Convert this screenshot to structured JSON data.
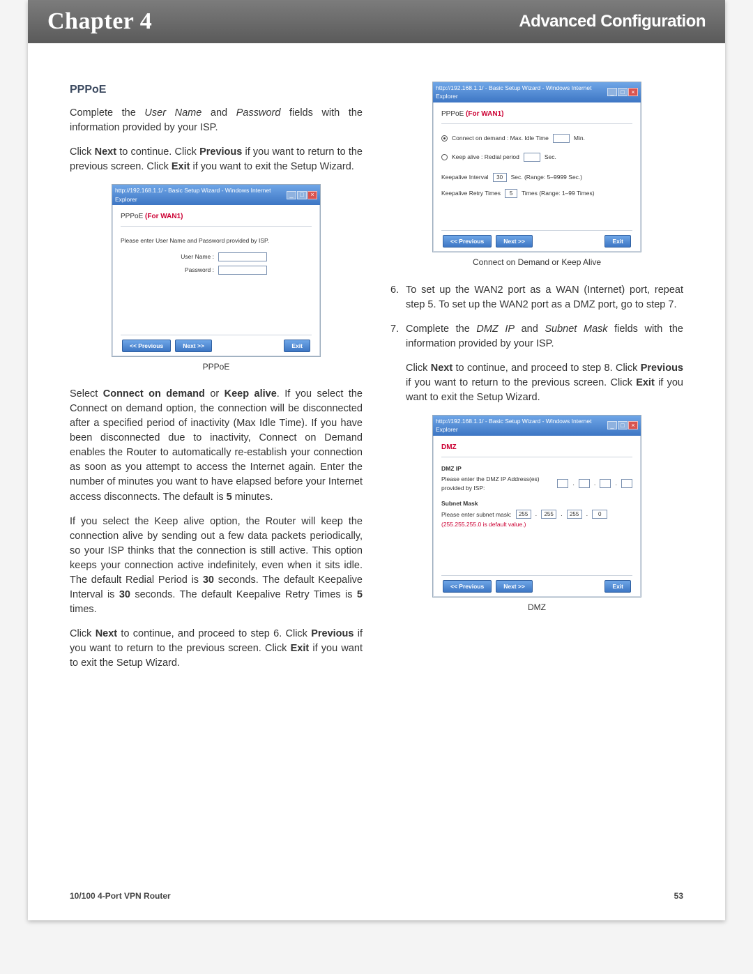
{
  "header": {
    "chapter": "Chapter 4",
    "section": "Advanced Configuration"
  },
  "left": {
    "heading": "PPPoE",
    "p1_a": "Complete the ",
    "p1_user_name": "User Name",
    "p1_b": " and ",
    "p1_password": "Password",
    "p1_c": " fields with the information provided by your ISP.",
    "p2_a": "Click ",
    "p2_next": "Next",
    "p2_b": " to continue. Click ",
    "p2_prev": "Previous",
    "p2_c": " if you want to return to the previous screen. Click ",
    "p2_exit": "Exit",
    "p2_d": " if you want to exit the Setup Wizard.",
    "fig1_caption": "PPPoE",
    "p3_a": "Select ",
    "p3_b1": "Connect on demand",
    "p3_b": " or ",
    "p3_b2": "Keep alive",
    "p3_c": ". If you select the Connect on demand option, the connection will be disconnected after a specified period of inactivity (Max Idle Time). If you have been disconnected due to inactivity, Connect on Demand enables the Router to automatically re-establish your connection as soon as you attempt to access the Internet again. Enter the number of minutes you want to have elapsed before your Internet access disconnects. The default is ",
    "p3_d": "5",
    "p3_e": " minutes.",
    "p4_a": "If you select the Keep alive option, the Router will keep the connection alive by sending out a few data packets periodically, so your ISP thinks that the connection is still active. This option keeps your connection active indefinitely, even when it sits idle. The default Redial Period is ",
    "p4_b1": "30",
    "p4_b": " seconds. The default Keepalive Interval is ",
    "p4_b2": "30",
    "p4_c": " seconds. The default Keepalive Retry Times is ",
    "p4_b3": "5",
    "p4_d": " times.",
    "p5_a": "Click ",
    "p5_next": "Next",
    "p5_b": " to continue, and proceed to step 6. Click ",
    "p5_prev": "Previous",
    "p5_c": " if you want to return to the previous screen. Click ",
    "p5_exit": "Exit",
    "p5_d": " if you want to exit the Setup Wizard."
  },
  "right": {
    "fig2_caption": "Connect on Demand or Keep Alive",
    "step6_num": "6.",
    "step6": "To set up the WAN2 port as a WAN (Internet) port, repeat step 5. To set up the WAN2 port as a DMZ port, go to step 7.",
    "step7_num": "7.",
    "step7_a": "Complete the ",
    "step7_dmz": "DMZ IP",
    "step7_b": " and ",
    "step7_sm": "Subnet Mask",
    "step7_c": " fields with the information provided by your ISP.",
    "p7b_a": "Click ",
    "p7b_next": "Next",
    "p7b_b": " to continue, and proceed to step 8. Click ",
    "p7b_prev": "Previous",
    "p7b_c": " if you want to return to the previous screen. Click ",
    "p7b_exit": "Exit",
    "p7b_d": " if you want to exit the Setup Wizard.",
    "fig3_caption": "DMZ"
  },
  "win": {
    "title": "http://192.168.1.1/ - Basic Setup Wizard - Windows Internet Explorer",
    "pppoe_header_a": "PPPoE ",
    "pppoe_header_b": "(For WAN1)",
    "pppoe_instruct": "Please enter User Name and Password provided by ISP.",
    "lbl_user": "User Name :",
    "lbl_pass": "Password :",
    "btn_prev": "<< Previous",
    "btn_next": "Next >>",
    "btn_exit": "Exit",
    "ka_connect_demand": "Connect on demand : Max. Idle Time",
    "ka_min": "Min.",
    "ka_keep_alive": "Keep alive : Redial period",
    "ka_sec": "Sec.",
    "ka_interval": "Keepalive Interval",
    "ka_interval_val": "30",
    "ka_interval_suffix": "Sec. (Range: 5–9999 Sec.)",
    "ka_retry": "Keepalive Retry Times",
    "ka_retry_val": "5",
    "ka_retry_suffix": "Times (Range: 1–99 Times)",
    "dmz_header": "DMZ",
    "dmz_ip_label": "DMZ IP",
    "dmz_ip_instruct": "Please enter the DMZ IP Address(es) provided by ISP:",
    "dmz_sm_label": "Subnet Mask",
    "dmz_sm_instruct": "Please enter subnet mask:",
    "dmz_sm_vals": [
      "255",
      "255",
      "255",
      "0"
    ],
    "dmz_sm_note": "(255.255.255.0 is default value.)"
  },
  "footer": {
    "product": "10/100 4-Port VPN Router",
    "page": "53"
  }
}
